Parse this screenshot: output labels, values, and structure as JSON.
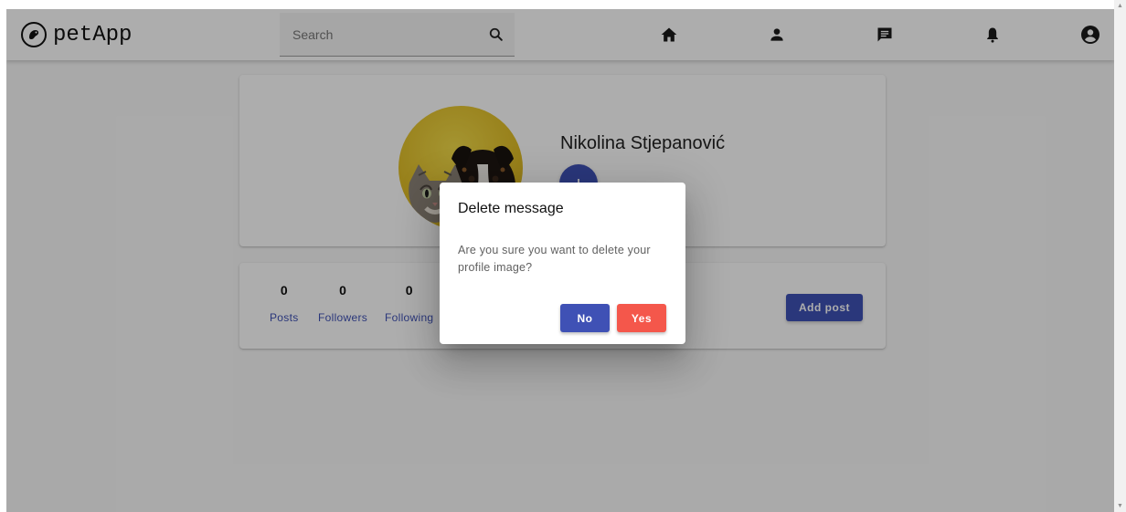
{
  "app": {
    "title": "petApp"
  },
  "search": {
    "placeholder": "Search",
    "icon": "search-icon"
  },
  "nav": {
    "items": [
      {
        "name": "home",
        "icon": "home-icon"
      },
      {
        "name": "profile",
        "icon": "person-icon"
      },
      {
        "name": "messages",
        "icon": "chat-icon"
      },
      {
        "name": "notifications",
        "icon": "bell-icon"
      },
      {
        "name": "account",
        "icon": "account-circle-icon"
      }
    ]
  },
  "profile": {
    "name": "Nikolina Stjepanović",
    "avatar": "cat-and-dog-photo",
    "upload_icon": "upload-icon"
  },
  "stats": [
    {
      "value": "0",
      "label": "Posts"
    },
    {
      "value": "0",
      "label": "Followers"
    },
    {
      "value": "0",
      "label": "Following"
    }
  ],
  "actions": {
    "add_post": "Add post"
  },
  "dialog": {
    "title": "Delete message",
    "text": "Are you sure you want to delete your profile image?",
    "no": "No",
    "yes": "Yes"
  },
  "colors": {
    "primary": "#3f51b5",
    "danger": "#f4574b",
    "avatar_background": "#e0bd27"
  }
}
